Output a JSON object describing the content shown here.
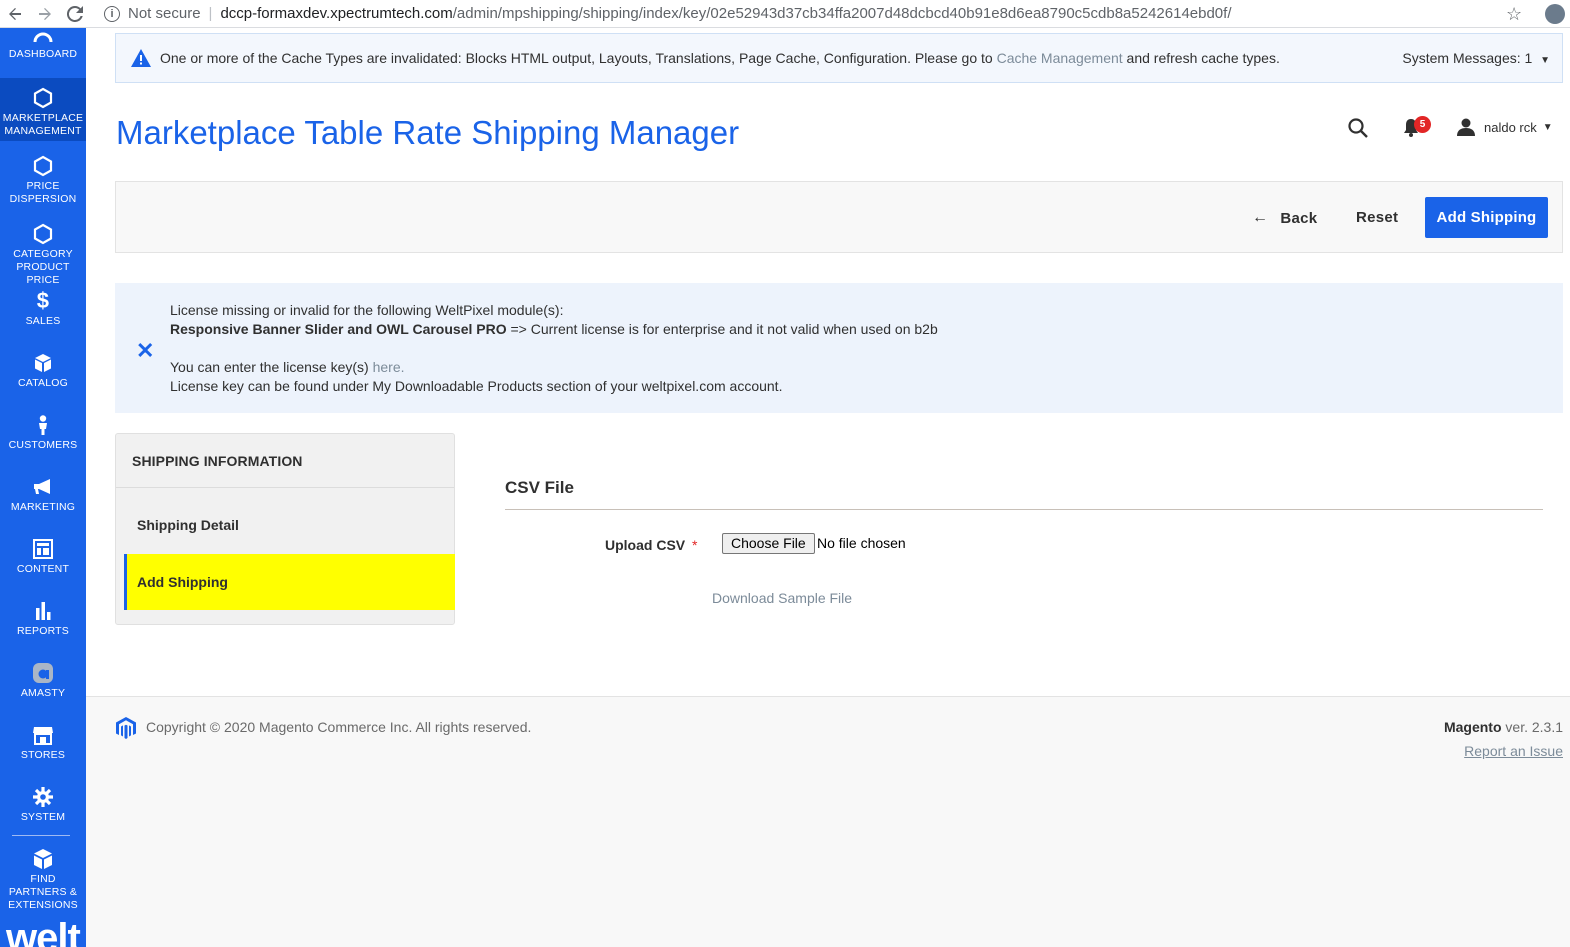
{
  "browser": {
    "security_label": "Not secure",
    "url_host": "dccp-formaxdev.xpectrumtech.com",
    "url_path": "/admin/mpshipping/shipping/index/key/02e52943d37cb34ffa2007d48dcbcd40b91e8d6ea8790c5cdb8a5242614ebd0f/"
  },
  "sidebar": {
    "items": [
      {
        "label": "DASHBOARD",
        "icon": "dashboard-icon"
      },
      {
        "label": "MARKETPLACE MANAGEMENT",
        "icon": "hexagon-icon"
      },
      {
        "label": "PRICE DISPERSION",
        "icon": "hexagon-icon"
      },
      {
        "label": "CATEGORY PRODUCT PRICE",
        "icon": "hexagon-icon"
      },
      {
        "label": "SALES",
        "icon": "dollar-icon"
      },
      {
        "label": "CATALOG",
        "icon": "box-icon"
      },
      {
        "label": "CUSTOMERS",
        "icon": "person-icon"
      },
      {
        "label": "MARKETING",
        "icon": "megaphone-icon"
      },
      {
        "label": "CONTENT",
        "icon": "layout-icon"
      },
      {
        "label": "REPORTS",
        "icon": "bar-chart-icon"
      },
      {
        "label": "AMASTY",
        "icon": "amasty-icon"
      },
      {
        "label": "STORES",
        "icon": "store-icon"
      },
      {
        "label": "SYSTEM",
        "icon": "gear-icon"
      },
      {
        "label": "FIND PARTNERS & EXTENSIONS",
        "icon": "cubes-icon"
      }
    ],
    "logo_text": "welt"
  },
  "system_message": {
    "text_before": "One or more of the Cache Types are invalidated: Blocks HTML output, Layouts, Translations, Page Cache, Configuration. Please go to ",
    "link": "Cache Management",
    "text_after": " and refresh cache types.",
    "count_label": "System Messages: 1"
  },
  "header": {
    "title": "Marketplace Table Rate Shipping Manager",
    "notifications_count": "5",
    "user_name": "naldo rck"
  },
  "actions": {
    "back": "Back",
    "reset": "Reset",
    "add_shipping": "Add Shipping"
  },
  "license_notice": {
    "line1": "License missing or invalid for the following WeltPixel module(s):",
    "module_name": "Responsive Banner Slider and OWL Carousel PRO",
    "module_reason": " => Current license is for enterprise and it not valid when used on b2b",
    "line3_before": "You can enter the license key(s) ",
    "line3_link": "here.",
    "line4": "License key can be found under My Downloadable Products section of your weltpixel.com account."
  },
  "tabs": {
    "title": "SHIPPING INFORMATION",
    "items": [
      {
        "label": "Shipping Detail",
        "active": false
      },
      {
        "label": "Add Shipping",
        "active": true
      }
    ]
  },
  "form": {
    "fieldset_title": "CSV File",
    "upload_label": "Upload CSV",
    "required_mark": "*",
    "file_button": "Choose File",
    "file_status": "No file chosen",
    "sample_link": "Download Sample File"
  },
  "footer": {
    "copyright": "Copyright © 2020 Magento Commerce Inc. All rights reserved.",
    "brand": "Magento",
    "version": " ver. 2.3.1",
    "report_link": "Report an Issue"
  },
  "colors": {
    "accent": "#1a63e8",
    "active_tab_bg": "#ffff00",
    "badge": "#e22626"
  }
}
